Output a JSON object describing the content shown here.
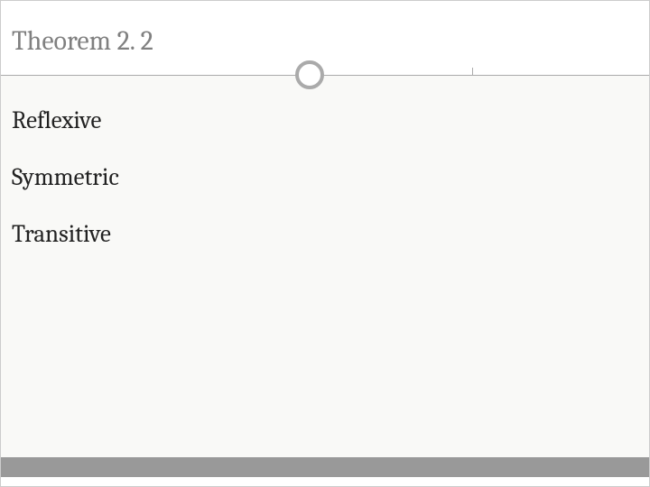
{
  "slide": {
    "title": "Theorem 2. 2",
    "body_items": [
      "Reflexive",
      "Symmetric",
      "Transitive"
    ]
  }
}
